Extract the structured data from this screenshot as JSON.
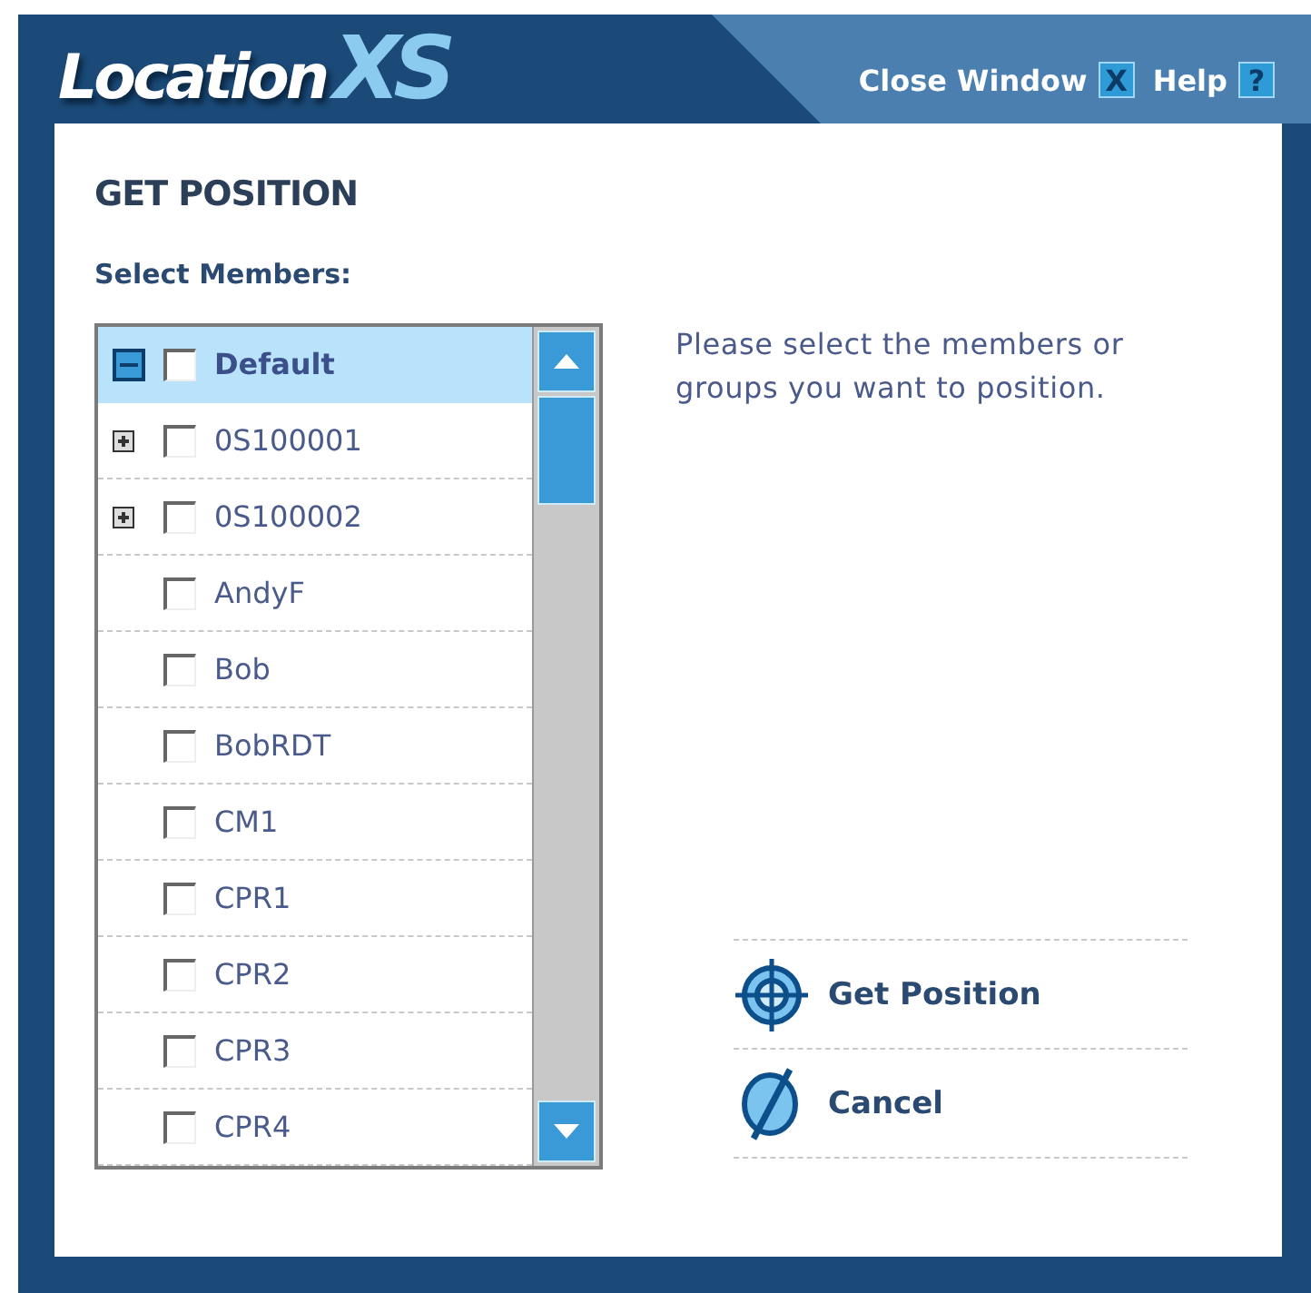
{
  "header": {
    "logo_main": "Location",
    "logo_accent": "XS",
    "links": [
      {
        "label": "Close Window",
        "icon_char": "X"
      },
      {
        "label": "Help",
        "icon_char": "?"
      }
    ]
  },
  "title": "GET POSITION",
  "members_label": "Select Members:",
  "members": [
    {
      "kind": "group",
      "name": "Default",
      "expanded": true,
      "checked": false,
      "selected": true
    },
    {
      "kind": "group",
      "name": "0S100001",
      "expanded": false,
      "checked": false,
      "selected": false
    },
    {
      "kind": "group",
      "name": "0S100002",
      "expanded": false,
      "checked": false,
      "selected": false
    },
    {
      "kind": "member",
      "name": "AndyF",
      "checked": false,
      "selected": false
    },
    {
      "kind": "member",
      "name": "Bob",
      "checked": false,
      "selected": false
    },
    {
      "kind": "member",
      "name": "BobRDT",
      "checked": false,
      "selected": false
    },
    {
      "kind": "member",
      "name": "CM1",
      "checked": false,
      "selected": false
    },
    {
      "kind": "member",
      "name": "CPR1",
      "checked": false,
      "selected": false
    },
    {
      "kind": "member",
      "name": "CPR2",
      "checked": false,
      "selected": false
    },
    {
      "kind": "member",
      "name": "CPR3",
      "checked": false,
      "selected": false
    },
    {
      "kind": "member",
      "name": "CPR4",
      "checked": false,
      "selected": false
    }
  ],
  "instructions": "Please select the members or groups you want to position.",
  "actions": [
    {
      "kind": "locate",
      "label": "Get Position"
    },
    {
      "kind": "cancel",
      "label": "Cancel"
    }
  ]
}
